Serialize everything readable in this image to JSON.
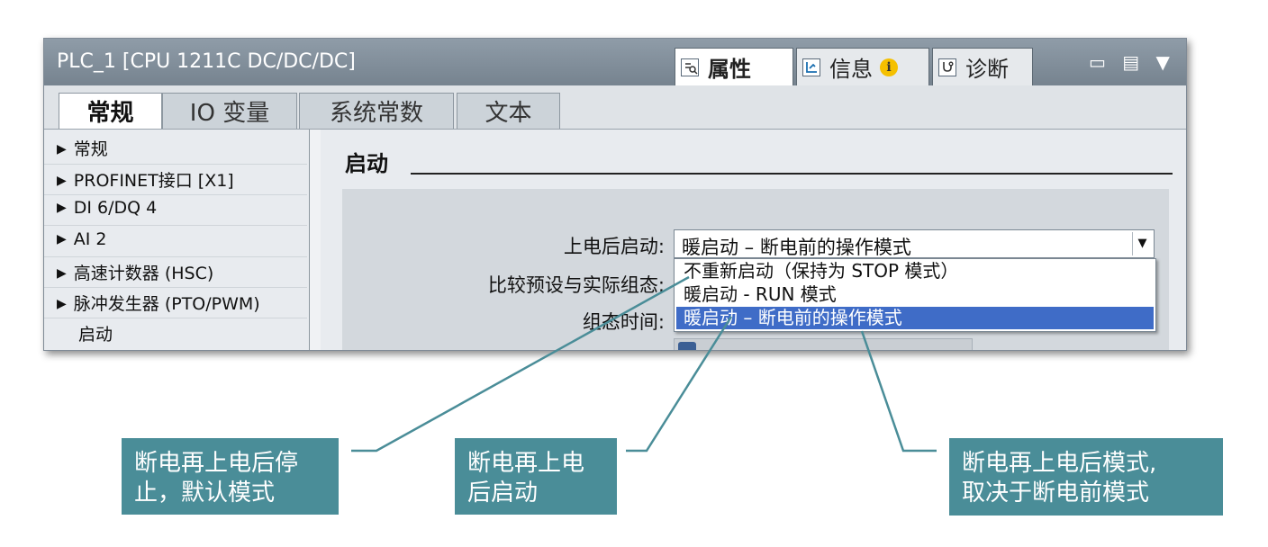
{
  "window": {
    "title": "PLC_1 [CPU 1211C DC/DC/DC]",
    "inspector_tabs": [
      {
        "label": "属性",
        "icon": "properties-icon",
        "active": true
      },
      {
        "label": "信息",
        "icon": "info-list-icon",
        "badge": "i",
        "active": false
      },
      {
        "label": "诊断",
        "icon": "diagnostics-icon",
        "active": false
      }
    ],
    "window_controls": "▭ ▤ ▼"
  },
  "property_tabs": [
    {
      "label": "常规",
      "active": true
    },
    {
      "label": "IO 变量",
      "active": false
    },
    {
      "label": "系统常数",
      "active": false
    },
    {
      "label": "文本",
      "active": false
    }
  ],
  "nav_items": [
    {
      "label": "常规",
      "expandable": true
    },
    {
      "label": "PROFINET接口 [X1]",
      "expandable": true
    },
    {
      "label": "DI 6/DQ 4",
      "expandable": true
    },
    {
      "label": "AI 2",
      "expandable": true
    },
    {
      "label": "高速计数器 (HSC)",
      "expandable": true
    },
    {
      "label": "脉冲发生器 (PTO/PWM)",
      "expandable": true
    },
    {
      "label": "启动",
      "expandable": false
    }
  ],
  "section": {
    "title": "启动",
    "fields": {
      "startup_after_power_on": "上电后启动:",
      "compare_config": "比较预设与实际组态:",
      "config_time": "组态时间:"
    },
    "startup_select": {
      "value": "暖启动 – 断电前的操作模式",
      "options": [
        "不重新启动（保持为 STOP 模式）",
        "暖启动 - RUN 模式",
        "暖启动 – 断电前的操作模式"
      ],
      "selected_index": 2
    }
  },
  "callouts": [
    {
      "line1": "断电再上电后停",
      "line2": "止，默认模式"
    },
    {
      "line1": "断电再上电",
      "line2": "后启动"
    },
    {
      "line1": "断电再上电后模式,",
      "line2": "取决于断电前模式"
    }
  ],
  "colors": {
    "callout_bg": "#4a8d98",
    "leader_line": "#4a8d98",
    "selection": "#3f6cc7",
    "titlebar": "#8f9ca8"
  }
}
